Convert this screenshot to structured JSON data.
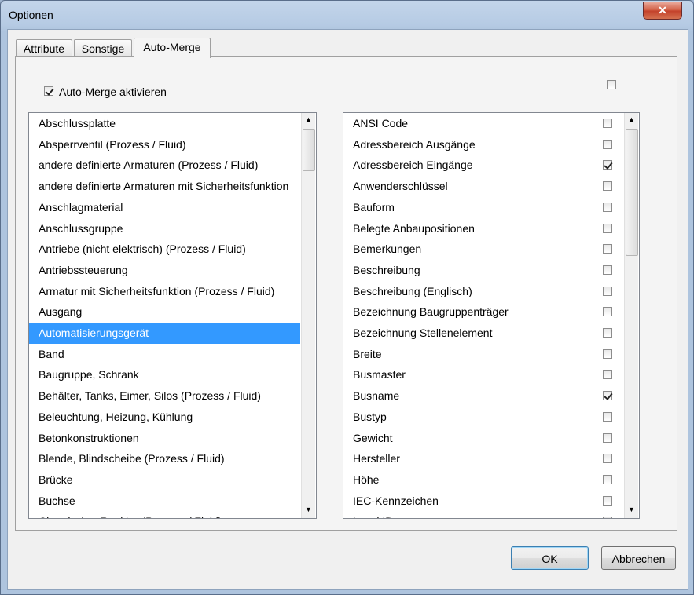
{
  "window": {
    "title": "Optionen",
    "close_label": "✕"
  },
  "tabs": [
    {
      "label": "Attribute"
    },
    {
      "label": "Sonstige"
    },
    {
      "label": "Auto-Merge"
    }
  ],
  "auto_merge": {
    "checkbox_label": "Auto-Merge aktivieren",
    "checked": true
  },
  "left_list": {
    "selected_index": 10,
    "items": [
      "Abschlussplatte",
      "Absperrventil (Prozess / Fluid)",
      "andere definierte Armaturen (Prozess / Fluid)",
      "andere definierte Armaturen mit Sicherheitsfunktion",
      "Anschlagmaterial",
      "Anschlussgruppe",
      "Antriebe (nicht elektrisch) (Prozess / Fluid)",
      "Antriebssteuerung",
      "Armatur mit Sicherheitsfunktion (Prozess / Fluid)",
      "Ausgang",
      "Automatisierungsgerät",
      "Band",
      "Baugruppe, Schrank",
      "Behälter, Tanks, Eimer, Silos (Prozess / Fluid)",
      "Beleuchtung, Heizung, Kühlung",
      "Betonkonstruktionen",
      "Blende, Blindscheibe (Prozess / Fluid)",
      "Brücke",
      "Buchse",
      "Chemischer Reaktor (Prozess / Fluid)"
    ]
  },
  "right_list": {
    "items": [
      {
        "label": "ANSI Code",
        "checked": false
      },
      {
        "label": "Adressbereich Ausgänge",
        "checked": false
      },
      {
        "label": "Adressbereich Eingänge",
        "checked": true
      },
      {
        "label": "Anwenderschlüssel",
        "checked": false
      },
      {
        "label": "Bauform",
        "checked": false
      },
      {
        "label": "Belegte Anbaupositionen",
        "checked": false
      },
      {
        "label": "Bemerkungen",
        "checked": false
      },
      {
        "label": "Beschreibung",
        "checked": false
      },
      {
        "label": "Beschreibung (Englisch)",
        "checked": false
      },
      {
        "label": "Bezeichnung Baugruppenträger",
        "checked": false
      },
      {
        "label": "Bezeichnung Stellenelement",
        "checked": false
      },
      {
        "label": "Breite",
        "checked": false
      },
      {
        "label": "Busmaster",
        "checked": false
      },
      {
        "label": "Busname",
        "checked": true
      },
      {
        "label": "Bustyp",
        "checked": false
      },
      {
        "label": "Gewicht",
        "checked": false
      },
      {
        "label": "Hersteller",
        "checked": false
      },
      {
        "label": "Höhe",
        "checked": false
      },
      {
        "label": "IEC-Kennzeichen",
        "checked": false
      },
      {
        "label": "Local ID",
        "checked": false
      }
    ]
  },
  "buttons": {
    "ok": "OK",
    "cancel": "Abbrechen"
  }
}
